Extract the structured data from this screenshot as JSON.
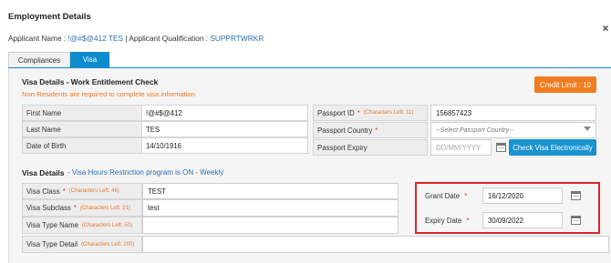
{
  "header": {
    "title": "Employment Details",
    "close_icon": "×",
    "applicant_name_label": "Applicant Name :",
    "applicant_name_value": "!@#$@412 TES",
    "separator": "|",
    "applicant_qual_label": "Applicant Qualification :",
    "applicant_qual_value": "SUPPRTWRKR"
  },
  "tabs": [
    "Compliances",
    "Visa"
  ],
  "visa_check": {
    "title": "Visa Details - Work Entitlement Check",
    "note": "Non-Residents are required to complete visa information",
    "credit_button": "Credit Limit : 10",
    "rows": [
      {
        "label": "First Name",
        "value": "!@#$@412"
      },
      {
        "label": "Last Name",
        "value": "TES"
      },
      {
        "label": "Date of Birth",
        "value": "14/10/1916"
      }
    ],
    "passport_id_label": "Passport ID",
    "passport_id_hint": "(Characters Left: 11)",
    "passport_id_value": "156857423",
    "passport_country_label": "Passport Country",
    "passport_country_placeholder": "--Select Passport Country--",
    "passport_expiry_label": "Passport Expiry",
    "passport_expiry_placeholder": "DD/MM/YYYY",
    "check_button": "Check Visa Electronically",
    "required_mark": "*"
  },
  "visa_details": {
    "title": "Visa Details",
    "subtitle": "- Visa Hours Restriction program is ON - Weekly",
    "rows": [
      {
        "label": "Visa Class",
        "required": "*",
        "hint": "(Characters Left: 46)",
        "value": "TEST"
      },
      {
        "label": "Visa Subclass",
        "required": "*",
        "hint": "(Characters Left: 21)",
        "value": "test"
      },
      {
        "label": "Visa Type Name",
        "required": "",
        "hint": "(Characters Left: 50)",
        "value": ""
      },
      {
        "label": "Visa Type Detail",
        "required": "",
        "hint": "(Characters Left: 200)",
        "value": ""
      }
    ],
    "grant_date_label": "Grant Date",
    "grant_date_value": "16/12/2020",
    "expiry_date_label": "Expiry Date",
    "expiry_date_value": "30/09/2022",
    "required_mark": "*"
  },
  "colors": {
    "accent": "#0d8bcf",
    "credit": "#f07d1f",
    "required": "#e03a2f",
    "highlight": "#d9252b"
  }
}
